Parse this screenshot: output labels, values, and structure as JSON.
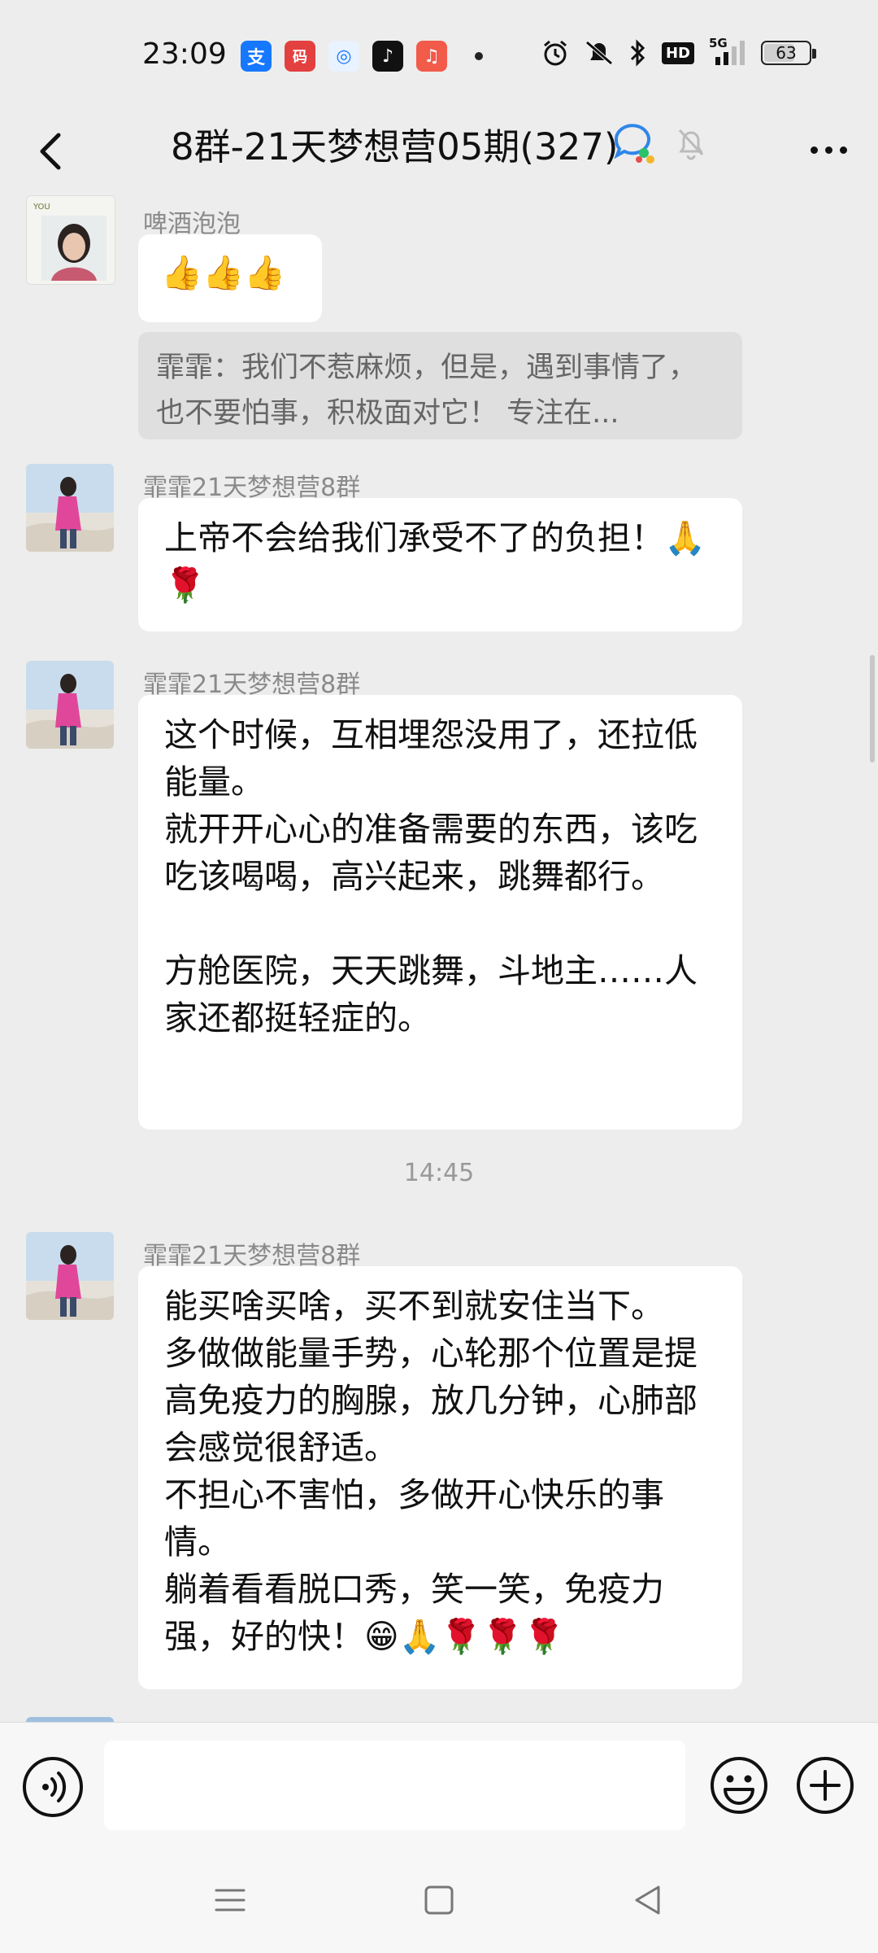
{
  "status_bar": {
    "time": "23:09",
    "app_icons": [
      {
        "name": "alipay-icon",
        "color": "#1677ff",
        "glyph": "支"
      },
      {
        "name": "nucleic-code-icon",
        "color": "#e34040",
        "glyph": "码"
      },
      {
        "name": "browser-icon",
        "color": "#e9f2ff",
        "glyph": "◎"
      },
      {
        "name": "tiktok-icon",
        "color": "#111111",
        "glyph": "♪"
      },
      {
        "name": "music-app-icon",
        "color": "#f25a4a",
        "glyph": "♫"
      }
    ],
    "network": "5G",
    "hd_label": "HD",
    "battery": 63
  },
  "header": {
    "title": "8群-21天梦想营05期(327)"
  },
  "messages": [
    {
      "sender": "啤酒泡泡",
      "text": "👍👍👍",
      "quote": "霏霏：我们不惹麻烦，但是，遇到事情了，也不要怕事，积极面对它！ 专注在..."
    },
    {
      "sender": "霏霏21天梦想营8群",
      "text": "上帝不会给我们承受不了的负担！🙏🌹"
    },
    {
      "sender": "霏霏21天梦想营8群",
      "text": "这个时候，互相埋怨没用了，还拉低能量。\n就开开心心的准备需要的东西，该吃吃该喝喝，高兴起来，跳舞都行。\n\n方舱医院，天天跳舞，斗地主……人家还都挺轻症的。"
    },
    {
      "sender": "霏霏21天梦想营8群",
      "text": "能买啥买啥，买不到就安住当下。\n多做做能量手势，心轮那个位置是提高免疫力的胸腺，放几分钟，心肺部会感觉很舒适。\n不担心不害怕，多做开心快乐的事情。\n躺着看看脱口秀，笑一笑，免疫力强，好的快！😁🙏🌹🌹🌹"
    }
  ],
  "time_divider": "14:45",
  "input": {
    "value": ""
  },
  "colors": {
    "background": "#ededed",
    "bubble": "#ffffff",
    "quote_bg": "#dfdfdf",
    "sender_text": "#8a8a8a"
  }
}
